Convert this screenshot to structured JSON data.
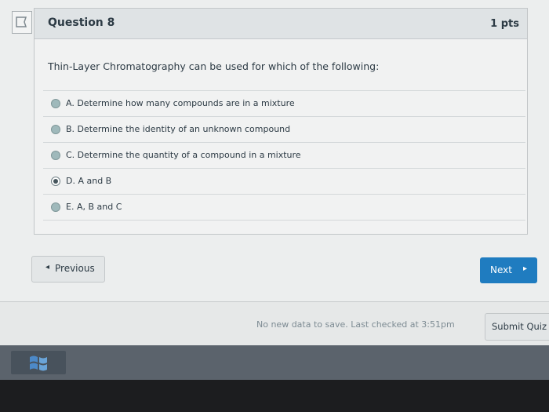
{
  "question": {
    "title": "Question 8",
    "points": "1 pts",
    "text": "Thin-Layer Chromatography can be used for which of the following:",
    "answers": [
      {
        "label": "A. Determine how many compounds are in a mixture",
        "selected": false
      },
      {
        "label": "B. Determine the identity of an unknown compound",
        "selected": false
      },
      {
        "label": "C. Determine the quantity of a compound in a mixture",
        "selected": false
      },
      {
        "label": "D. A and B",
        "selected": true
      },
      {
        "label": "E. A, B and C",
        "selected": false
      }
    ]
  },
  "navigation": {
    "previous_label": "Previous",
    "next_label": "Next"
  },
  "footer": {
    "save_status": "No new data to save. Last checked at 3:51pm",
    "submit_label": "Submit Quiz"
  },
  "colors": {
    "accent": "#1f7cc0",
    "text": "#2d3b45",
    "radio": "#9fb9bb"
  },
  "icons": [
    "flag-icon",
    "chevron-left-icon",
    "chevron-right-icon",
    "windows-start-icon"
  ]
}
